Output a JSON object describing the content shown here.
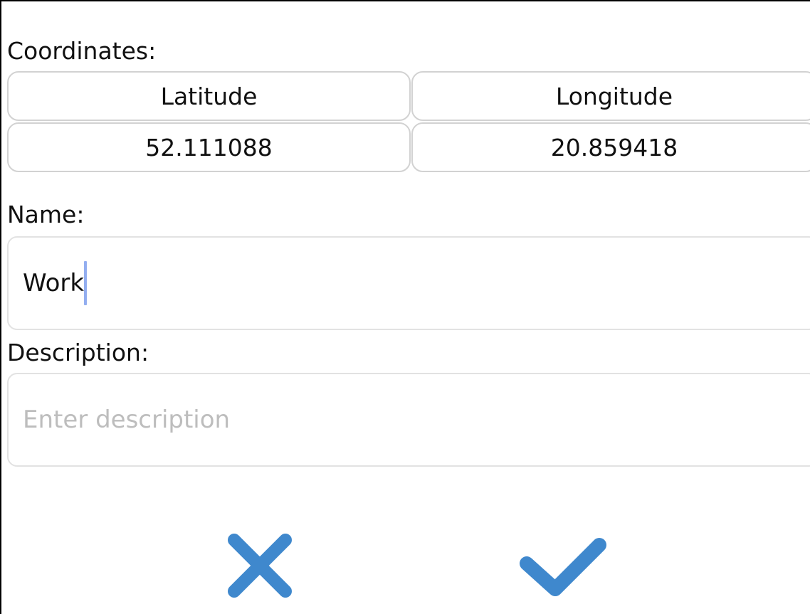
{
  "coordinates": {
    "label": "Coordinates:",
    "headers": {
      "latitude": "Latitude",
      "longitude": "Longitude"
    },
    "values": {
      "latitude": "52.111088",
      "longitude": "20.859418"
    }
  },
  "name": {
    "label": "Name:",
    "value": "Work"
  },
  "description": {
    "label": "Description:",
    "value": "",
    "placeholder": "Enter description"
  },
  "actions": {
    "cancel_icon": "close-icon",
    "confirm_icon": "checkmark-icon"
  },
  "colors": {
    "accent": "#3f88cd",
    "caret": "#93aef0",
    "border": "#d2d2d2",
    "placeholder": "#bdbdbd"
  }
}
